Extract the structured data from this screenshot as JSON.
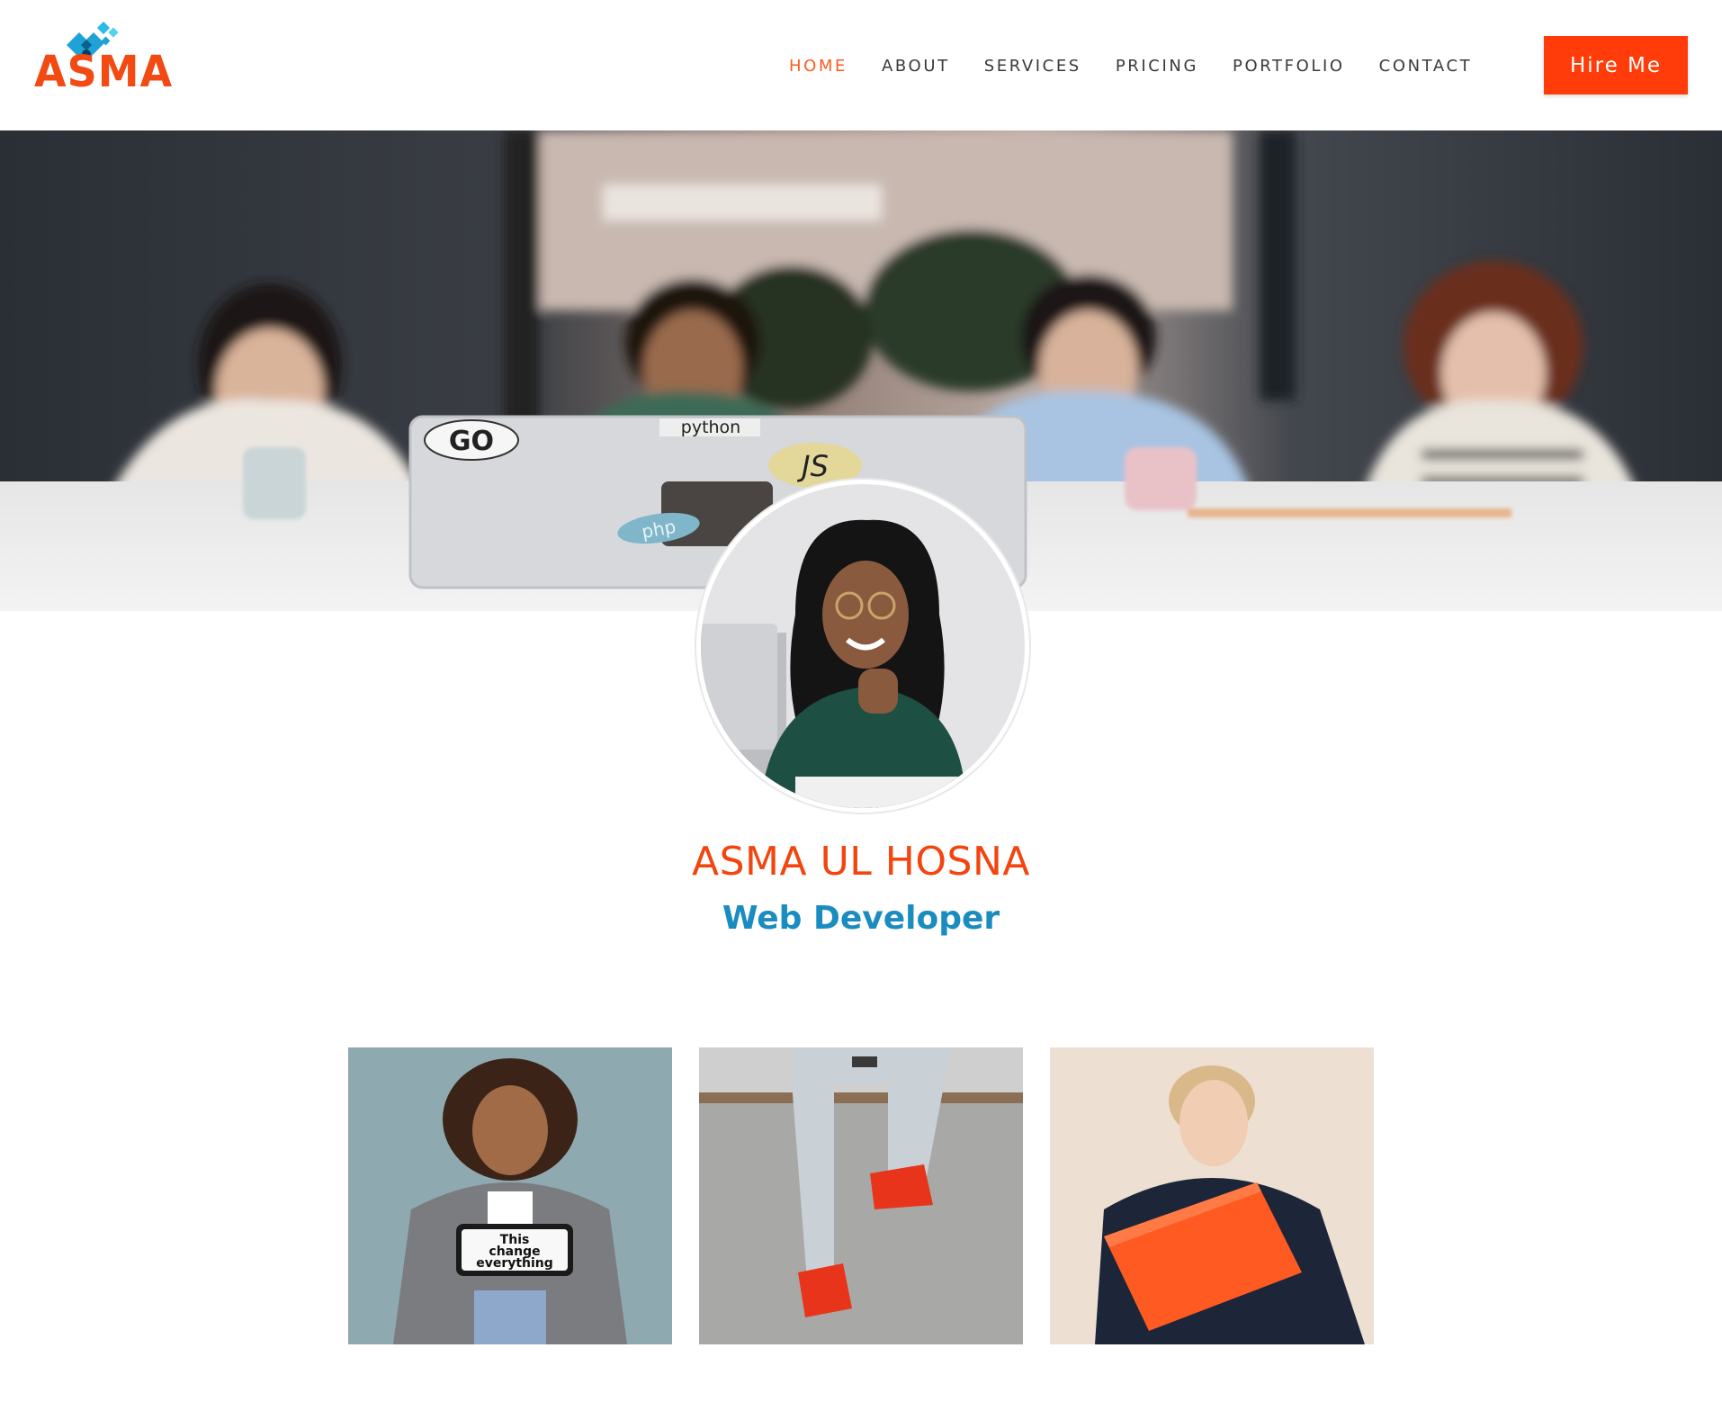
{
  "brand": {
    "logo_text": "ASMA",
    "accent": "#ff3c0a",
    "logo_color": "#f24a12",
    "logo_icon": "puzzle-cube-icon",
    "logo_icon_color": "#1fa3d6"
  },
  "nav": {
    "items": [
      {
        "label": "HOME",
        "active": true
      },
      {
        "label": "ABOUT",
        "active": false
      },
      {
        "label": "SERVICES",
        "active": false
      },
      {
        "label": "PRICING",
        "active": false
      },
      {
        "label": "PORTFOLIO",
        "active": false
      },
      {
        "label": "CONTACT",
        "active": false
      }
    ],
    "cta_label": "Hire Me"
  },
  "hero": {
    "stickers": {
      "go": "GO",
      "python": "python",
      "js": "JS",
      "php": "php"
    }
  },
  "profile": {
    "name": "ASMA UL HOSNA",
    "role": "Web Developer",
    "name_color": "#f2450f",
    "role_color": "#1a8cc0"
  },
  "gallery": {
    "cards": [
      {
        "tablet_text_line1": "This",
        "tablet_text_line2": "change",
        "tablet_text_line3": "everything"
      },
      {},
      {}
    ]
  }
}
